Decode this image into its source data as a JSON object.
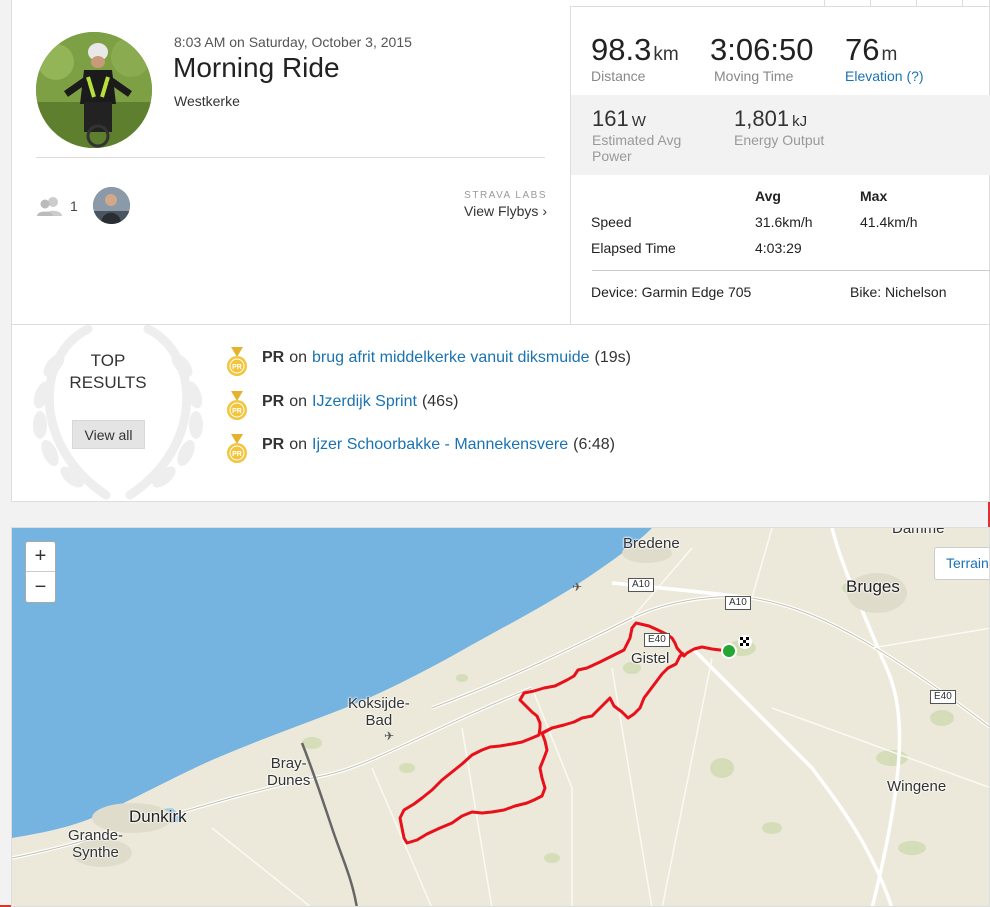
{
  "activity": {
    "datetime": "8:03 AM on Saturday, October 3, 2015",
    "title": "Morning Ride",
    "location": "Westkerke",
    "kudos_count": "1",
    "labs_label": "STRAVA LABS",
    "flyby_link": "View Flybys"
  },
  "stats": {
    "distance": {
      "value": "98.3",
      "unit": "km",
      "label": "Distance"
    },
    "moving_time": {
      "value": "3:06:50",
      "label": "Moving Time"
    },
    "elevation": {
      "value": "76",
      "unit": "m",
      "label": "Elevation (?)"
    },
    "power": {
      "value": "161",
      "unit": "W",
      "label": "Estimated Avg Power"
    },
    "energy": {
      "value": "1,801",
      "unit": "kJ",
      "label": "Energy Output"
    }
  },
  "detail_table": {
    "headers": [
      "",
      "Avg",
      "Max"
    ],
    "rows": [
      {
        "label": "Speed",
        "avg": "31.6km/h",
        "max": "41.4km/h"
      },
      {
        "label": "Elapsed Time",
        "avg": "4:03:29",
        "max": ""
      }
    ],
    "device": "Device: Garmin Edge 705",
    "bike": "Bike: Nichelson"
  },
  "top_results": {
    "title_line1": "TOP",
    "title_line2": "RESULTS",
    "view_all": "View all",
    "items": [
      {
        "badge": "PR",
        "on": "on",
        "segment": "brug afrit middelkerke vanuit diksmuide",
        "time": "(19s)"
      },
      {
        "badge": "PR",
        "on": "on",
        "segment": "IJzerdijk Sprint",
        "time": "(46s)"
      },
      {
        "badge": "PR",
        "on": "on",
        "segment": "Ijzer Schoorbakke - Mannekensvere",
        "time": "(6:48)"
      }
    ]
  },
  "map": {
    "zoom_in": "+",
    "zoom_out": "−",
    "terrain_label": "Terrain",
    "places": {
      "bredene": "Bredene",
      "bruges": "Bruges",
      "gistel": "Gistel",
      "koksijde1": "Koksijde-",
      "koksijde2": "Bad",
      "bray1": "Bray-",
      "bray2": "Dunes",
      "dunkirk": "Dunkirk",
      "grande1": "Grande-",
      "grande2": "Synthe",
      "wingene": "Wingene",
      "damme": "Damme"
    },
    "roads": {
      "a10a": "A10",
      "a10b": "A10",
      "e40a": "E40",
      "e40b": "E40"
    },
    "colors": {
      "sea": "#75b3e0",
      "land": "#ece9da",
      "route": "#e8101a",
      "start": "#22a832"
    }
  }
}
